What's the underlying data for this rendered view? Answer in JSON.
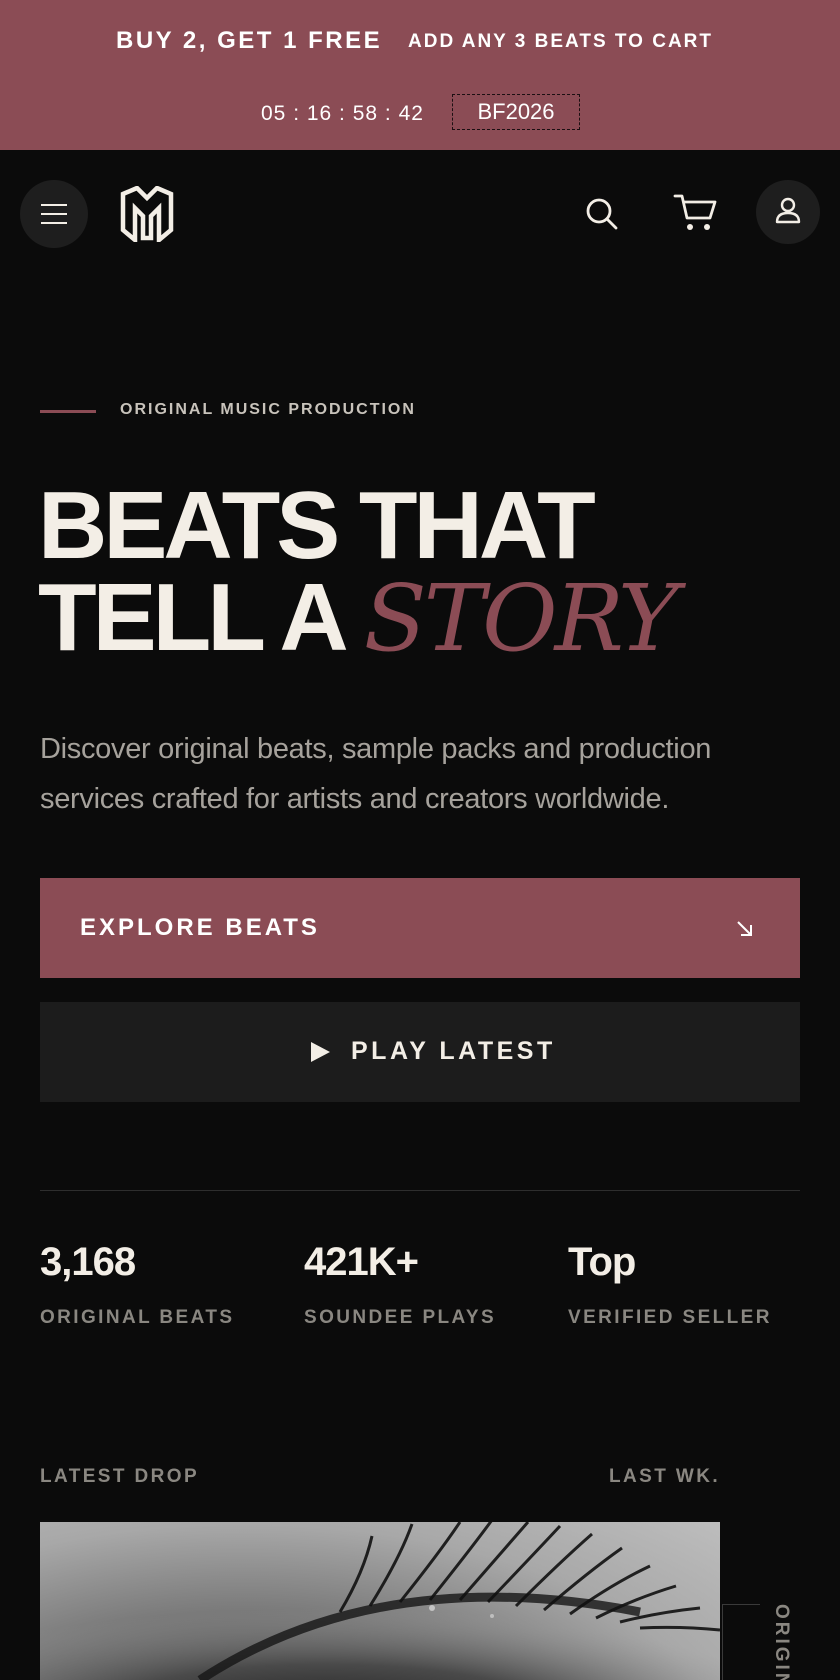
{
  "promo": {
    "offer": "BUY 2, GET 1 FREE",
    "sub": "ADD ANY 3 BEATS TO CART",
    "countdown": "05 : 16 : 58 : 42",
    "code": "BF2026"
  },
  "header": {
    "menu_icon": "hamburger-menu-icon",
    "logo_icon": "m-monogram-logo",
    "search_icon": "search-icon",
    "cart_icon": "shopping-cart-icon",
    "account_icon": "user-icon"
  },
  "hero": {
    "eyebrow": "ORIGINAL MUSIC PRODUCTION",
    "headline_line1": "BEATS THAT",
    "headline_line2": "TELL A",
    "headline_accent": "STORY",
    "lede": "Discover original beats, sample packs and production services crafted for artists and creators worldwide.",
    "cta_primary": "EXPLORE BEATS",
    "cta_primary_icon": "arrow-down-right-icon",
    "cta_secondary": "PLAY LATEST",
    "cta_secondary_icon": "play-icon"
  },
  "stats": [
    {
      "value": "3,168",
      "label": "ORIGINAL BEATS"
    },
    {
      "value": "421K+",
      "label": "SOUNDEE PLAYS"
    },
    {
      "value": "Top",
      "label": "VERIFIED SELLER"
    }
  ],
  "latest": {
    "label": "LATEST DROP",
    "when": "LAST WK.",
    "side_text": "ORIGIN"
  },
  "colors": {
    "accent": "#8b4c55",
    "background": "#0b0b0b",
    "text": "#f3eee6",
    "muted": "#8a8781"
  }
}
